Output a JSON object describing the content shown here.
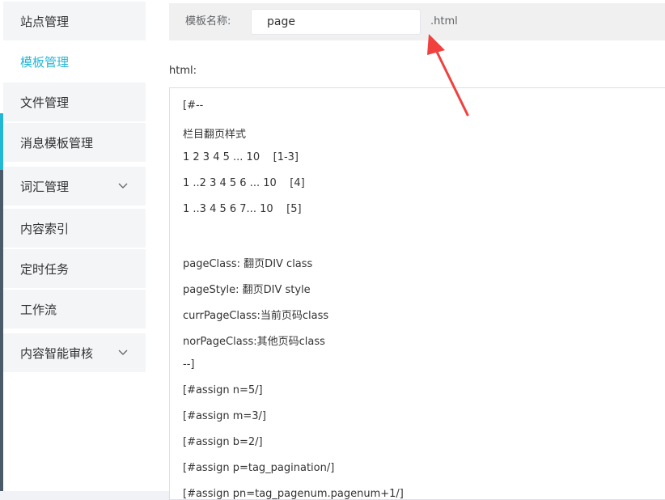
{
  "sidebar": {
    "items": [
      {
        "label": "站点管理",
        "active": false
      },
      {
        "label": "模板管理",
        "active": true
      },
      {
        "label": "文件管理",
        "active": false
      },
      {
        "label": "消息模板管理",
        "active": false
      },
      {
        "label": "词汇管理",
        "active": false,
        "expandable": true
      },
      {
        "label": "内容索引",
        "active": false
      },
      {
        "label": "定时任务",
        "active": false
      },
      {
        "label": "工作流",
        "active": false
      },
      {
        "label": "内容智能审核",
        "active": false,
        "expandable": true
      }
    ],
    "accent_color": "#23b7d6"
  },
  "template_form": {
    "name_label": "模板名称:",
    "name_value": "page",
    "name_suffix": ".html",
    "html_label": "html:"
  },
  "code_lines": [
    "[#--",
    "栏目翻页样式",
    "1 2 3 4 5 ... 10    [1-3]",
    "1 ..2 3 4 5 6 ... 10    [4]",
    "1 ..3 4 5 6 7... 10    [5]",
    "",
    "pageClass: 翻页DIV class",
    "pageStyle: 翻页DIV style",
    "currPageClass:当前页码class",
    "norPageClass:其他页码class",
    "--]",
    "[#assign n=5/]",
    "[#assign m=3/]",
    "[#assign b=2/]",
    "[#assign p=tag_pagination/]",
    "[#assign pn=tag_pagenum.pagenum+1/]"
  ],
  "annotation": {
    "icon": "red-arrow-icon",
    "color": "#f0413e"
  }
}
